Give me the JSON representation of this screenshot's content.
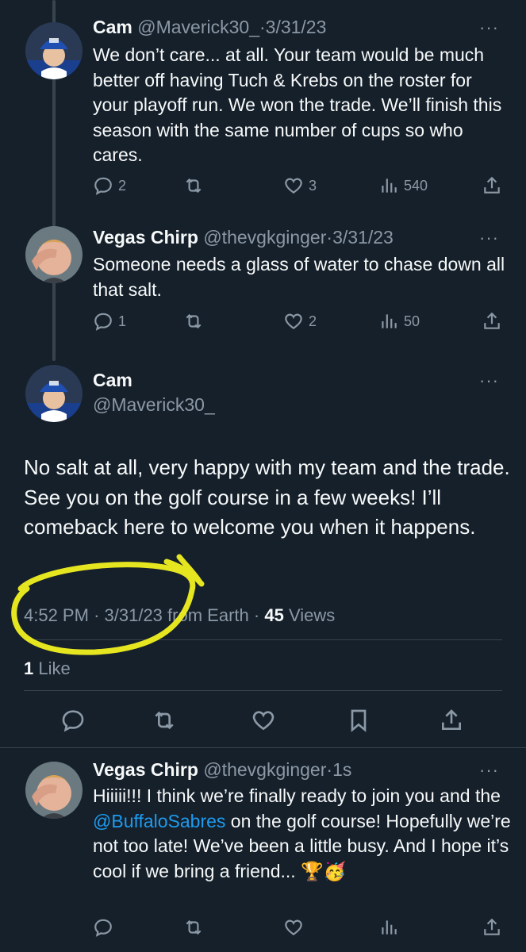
{
  "tweets": [
    {
      "name": "Cam",
      "handle": "@Maverick30_",
      "date": "3/31/23",
      "text": "We don’t care... at all. Your team would be much better off having Tuch & Krebs on the roster for your playoff run. We won the trade. We’ll finish this season with the same number of cups so who cares.",
      "replies": "2",
      "likes": "3",
      "views": "540"
    },
    {
      "name": "Vegas Chirp",
      "handle": "@thevgkginger",
      "date": "3/31/23",
      "text": "Someone needs a glass of water to chase down all that salt.",
      "replies": "1",
      "likes": "2",
      "views": "50"
    }
  ],
  "main": {
    "name": "Cam",
    "handle": "@Maverick30_",
    "text": "No salt at all, very happy with my team and the trade. See you on the golf course in a few weeks! I’ll comeback here to welcome you when it happens.",
    "time": "4:52 PM",
    "date": "3/31/23",
    "from": "from Earth",
    "views_count": "45",
    "views_label": "Views",
    "likes_count": "1",
    "likes_label": "Like"
  },
  "reply": {
    "name": "Vegas Chirp",
    "handle": "@thevgkginger",
    "time": "1s",
    "text_part1": "Hiiiii!!! I think we’re finally ready to join you and the ",
    "mention": "@BuffaloSabres",
    "text_part2": " on the golf course! Hopefully we’re not too late! We’ve been a little busy. And I hope it’s cool if we bring a friend...",
    "emoji": "🏆🥳"
  },
  "separator": "·",
  "more_glyph": "···",
  "highlight_color": "#f0f020",
  "accent_color": "#1d9bf0"
}
